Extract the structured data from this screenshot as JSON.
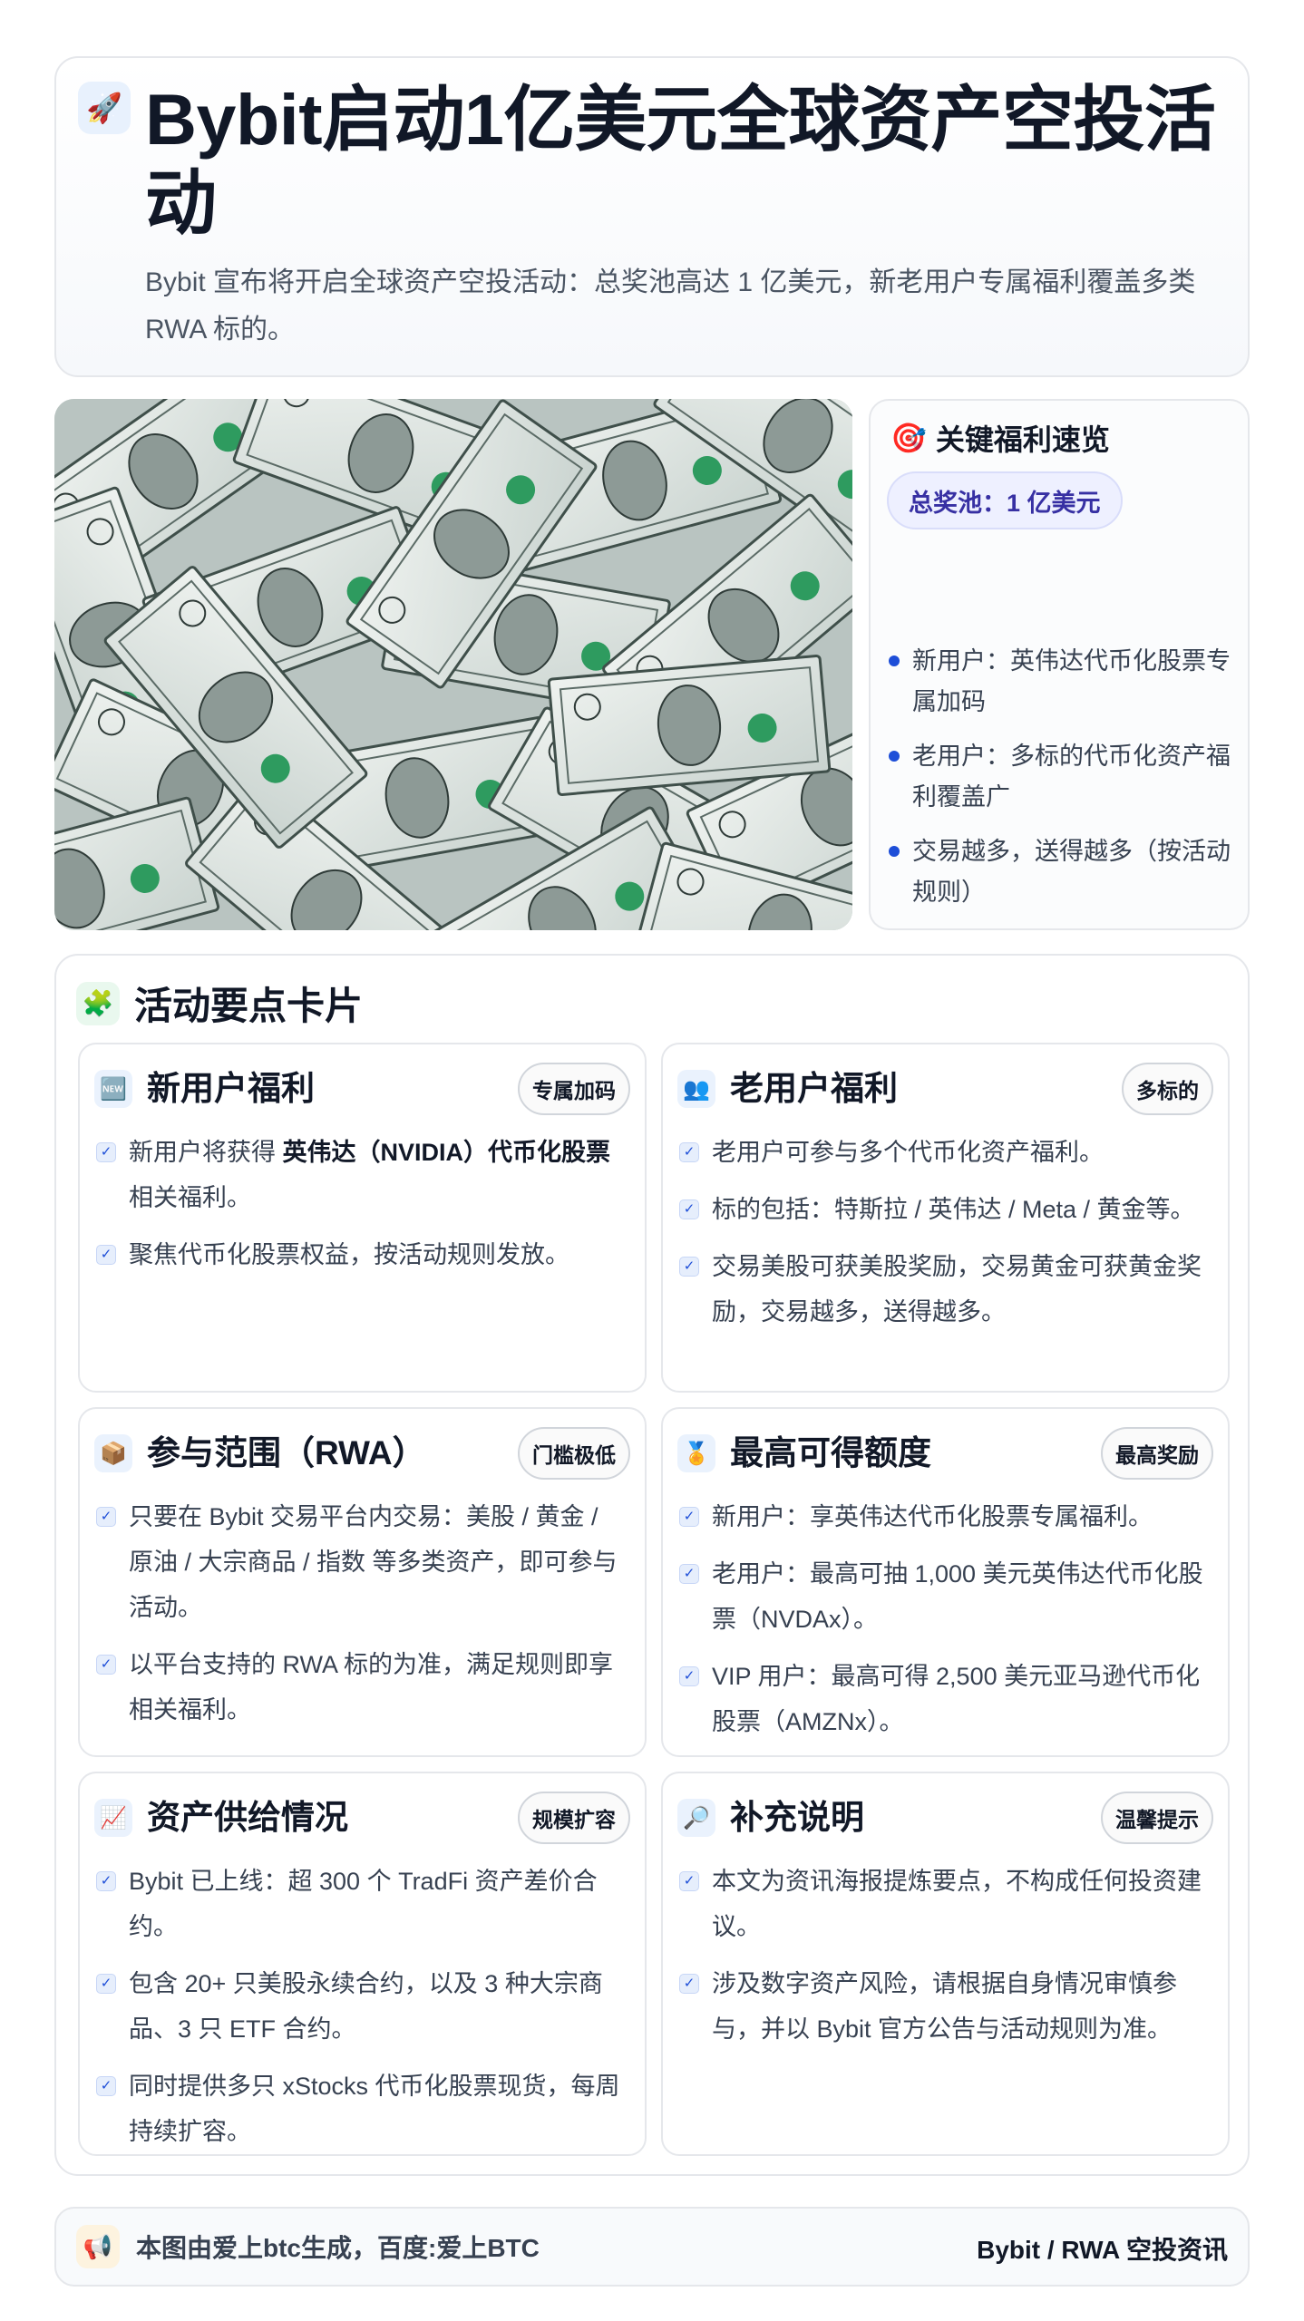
{
  "header": {
    "icon": "rocket-icon",
    "title": "Bybit启动1亿美元全球资产空投活动",
    "subtitle": "Bybit 宣布将开启全球资产空投活动：总奖池高达 1 亿美元，新老用户专属福利覆盖多类 RWA 标的。"
  },
  "photo": {
    "description_icon": "dollar-bills-image"
  },
  "key_benefits": {
    "icon": "target-icon",
    "title": "关键福利速览",
    "pool": "总奖池：1 亿美元",
    "items": [
      "新用户：英伟达代币化股票专属加码",
      "老用户：多标的代币化资产福利覆盖广",
      "交易越多，送得越多（按活动规则）"
    ]
  },
  "section": {
    "icon": "puzzle-icon",
    "title": "活动要点卡片",
    "cards": [
      {
        "icon": "new-badge-icon",
        "title": "新用户福利",
        "tag": "专属加码",
        "items": [
          {
            "pre": "新用户将获得 ",
            "bold": "英伟达（NVIDIA）代币化股票",
            "post": " 相关福利。"
          },
          {
            "pre": "聚焦代币化股票权益，按活动规则发放。",
            "bold": "",
            "post": ""
          }
        ]
      },
      {
        "icon": "users-icon",
        "title": "老用户福利",
        "tag": "多标的",
        "items": [
          {
            "pre": "老用户可参与多个代币化资产福利。",
            "bold": "",
            "post": ""
          },
          {
            "pre": "标的包括：特斯拉 / 英伟达 / Meta / 黄金等。",
            "bold": "",
            "post": ""
          },
          {
            "pre": "交易美股可获美股奖励，交易黄金可获黄金奖励，交易越多，送得越多。",
            "bold": "",
            "post": ""
          }
        ]
      },
      {
        "icon": "package-icon",
        "title": "参与范围（RWA）",
        "tag": "门槛极低",
        "items": [
          {
            "pre": "只要在 Bybit 交易平台内交易：美股 / 黄金 / 原油 / 大宗商品 / 指数 等多类资产，即可参与活动。",
            "bold": "",
            "post": ""
          },
          {
            "pre": "以平台支持的 RWA 标的为准，满足规则即享相关福利。",
            "bold": "",
            "post": ""
          }
        ]
      },
      {
        "icon": "medal-icon",
        "title": "最高可得额度",
        "tag": "最高奖励",
        "items": [
          {
            "pre": "新用户：享英伟达代币化股票专属福利。",
            "bold": "",
            "post": ""
          },
          {
            "pre": "老用户：最高可抽 1,000 美元英伟达代币化股票（NVDAx）。",
            "bold": "",
            "post": ""
          },
          {
            "pre": "VIP 用户：最高可得 2,500 美元亚马逊代币化股票（AMZNx）。",
            "bold": "",
            "post": ""
          }
        ]
      },
      {
        "icon": "chart-up-icon",
        "title": "资产供给情况",
        "tag": "规模扩容",
        "items": [
          {
            "pre": "Bybit 已上线：超 300 个 TradFi 资产差价合约。",
            "bold": "",
            "post": ""
          },
          {
            "pre": "包含 20+ 只美股永续合约，以及 3 种大宗商品、3 只 ETF 合约。",
            "bold": "",
            "post": ""
          },
          {
            "pre": "同时提供多只 xStocks 代币化股票现货，每周持续扩容。",
            "bold": "",
            "post": ""
          }
        ]
      },
      {
        "icon": "magnifier-icon",
        "title": "补充说明",
        "tag": "温馨提示",
        "items": [
          {
            "pre": "本文为资讯海报提炼要点，不构成任何投资建议。",
            "bold": "",
            "post": ""
          },
          {
            "pre": "涉及数字资产风险，请根据自身情况审慎参与，并以 Bybit 官方公告与活动规则为准。",
            "bold": "",
            "post": ""
          }
        ]
      }
    ]
  },
  "footer": {
    "icon": "megaphone-icon",
    "text": "本图由爱上btc生成，百度:爱上BTC",
    "right": "Bybit / RWA 空投资讯"
  }
}
